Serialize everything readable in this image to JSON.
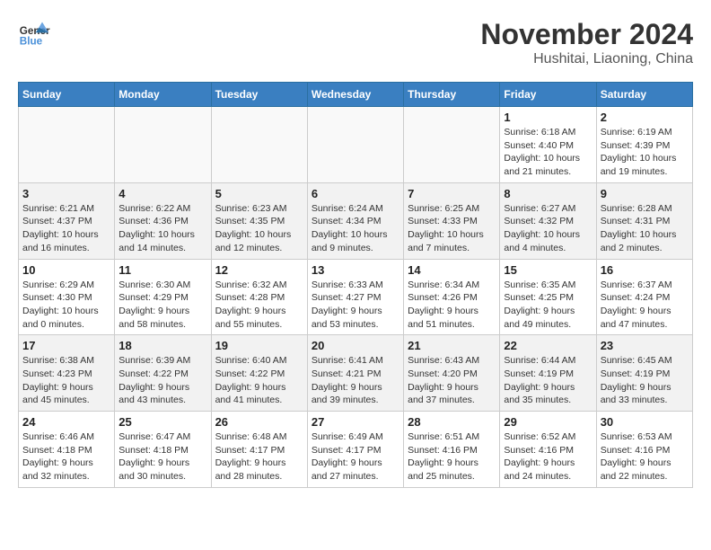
{
  "header": {
    "logo_line1": "General",
    "logo_line2": "Blue",
    "month": "November 2024",
    "location": "Hushitai, Liaoning, China"
  },
  "days_of_week": [
    "Sunday",
    "Monday",
    "Tuesday",
    "Wednesday",
    "Thursday",
    "Friday",
    "Saturday"
  ],
  "weeks": [
    [
      {
        "day": "",
        "info": ""
      },
      {
        "day": "",
        "info": ""
      },
      {
        "day": "",
        "info": ""
      },
      {
        "day": "",
        "info": ""
      },
      {
        "day": "",
        "info": ""
      },
      {
        "day": "1",
        "info": "Sunrise: 6:18 AM\nSunset: 4:40 PM\nDaylight: 10 hours and 21 minutes."
      },
      {
        "day": "2",
        "info": "Sunrise: 6:19 AM\nSunset: 4:39 PM\nDaylight: 10 hours and 19 minutes."
      }
    ],
    [
      {
        "day": "3",
        "info": "Sunrise: 6:21 AM\nSunset: 4:37 PM\nDaylight: 10 hours and 16 minutes."
      },
      {
        "day": "4",
        "info": "Sunrise: 6:22 AM\nSunset: 4:36 PM\nDaylight: 10 hours and 14 minutes."
      },
      {
        "day": "5",
        "info": "Sunrise: 6:23 AM\nSunset: 4:35 PM\nDaylight: 10 hours and 12 minutes."
      },
      {
        "day": "6",
        "info": "Sunrise: 6:24 AM\nSunset: 4:34 PM\nDaylight: 10 hours and 9 minutes."
      },
      {
        "day": "7",
        "info": "Sunrise: 6:25 AM\nSunset: 4:33 PM\nDaylight: 10 hours and 7 minutes."
      },
      {
        "day": "8",
        "info": "Sunrise: 6:27 AM\nSunset: 4:32 PM\nDaylight: 10 hours and 4 minutes."
      },
      {
        "day": "9",
        "info": "Sunrise: 6:28 AM\nSunset: 4:31 PM\nDaylight: 10 hours and 2 minutes."
      }
    ],
    [
      {
        "day": "10",
        "info": "Sunrise: 6:29 AM\nSunset: 4:30 PM\nDaylight: 10 hours and 0 minutes."
      },
      {
        "day": "11",
        "info": "Sunrise: 6:30 AM\nSunset: 4:29 PM\nDaylight: 9 hours and 58 minutes."
      },
      {
        "day": "12",
        "info": "Sunrise: 6:32 AM\nSunset: 4:28 PM\nDaylight: 9 hours and 55 minutes."
      },
      {
        "day": "13",
        "info": "Sunrise: 6:33 AM\nSunset: 4:27 PM\nDaylight: 9 hours and 53 minutes."
      },
      {
        "day": "14",
        "info": "Sunrise: 6:34 AM\nSunset: 4:26 PM\nDaylight: 9 hours and 51 minutes."
      },
      {
        "day": "15",
        "info": "Sunrise: 6:35 AM\nSunset: 4:25 PM\nDaylight: 9 hours and 49 minutes."
      },
      {
        "day": "16",
        "info": "Sunrise: 6:37 AM\nSunset: 4:24 PM\nDaylight: 9 hours and 47 minutes."
      }
    ],
    [
      {
        "day": "17",
        "info": "Sunrise: 6:38 AM\nSunset: 4:23 PM\nDaylight: 9 hours and 45 minutes."
      },
      {
        "day": "18",
        "info": "Sunrise: 6:39 AM\nSunset: 4:22 PM\nDaylight: 9 hours and 43 minutes."
      },
      {
        "day": "19",
        "info": "Sunrise: 6:40 AM\nSunset: 4:22 PM\nDaylight: 9 hours and 41 minutes."
      },
      {
        "day": "20",
        "info": "Sunrise: 6:41 AM\nSunset: 4:21 PM\nDaylight: 9 hours and 39 minutes."
      },
      {
        "day": "21",
        "info": "Sunrise: 6:43 AM\nSunset: 4:20 PM\nDaylight: 9 hours and 37 minutes."
      },
      {
        "day": "22",
        "info": "Sunrise: 6:44 AM\nSunset: 4:19 PM\nDaylight: 9 hours and 35 minutes."
      },
      {
        "day": "23",
        "info": "Sunrise: 6:45 AM\nSunset: 4:19 PM\nDaylight: 9 hours and 33 minutes."
      }
    ],
    [
      {
        "day": "24",
        "info": "Sunrise: 6:46 AM\nSunset: 4:18 PM\nDaylight: 9 hours and 32 minutes."
      },
      {
        "day": "25",
        "info": "Sunrise: 6:47 AM\nSunset: 4:18 PM\nDaylight: 9 hours and 30 minutes."
      },
      {
        "day": "26",
        "info": "Sunrise: 6:48 AM\nSunset: 4:17 PM\nDaylight: 9 hours and 28 minutes."
      },
      {
        "day": "27",
        "info": "Sunrise: 6:49 AM\nSunset: 4:17 PM\nDaylight: 9 hours and 27 minutes."
      },
      {
        "day": "28",
        "info": "Sunrise: 6:51 AM\nSunset: 4:16 PM\nDaylight: 9 hours and 25 minutes."
      },
      {
        "day": "29",
        "info": "Sunrise: 6:52 AM\nSunset: 4:16 PM\nDaylight: 9 hours and 24 minutes."
      },
      {
        "day": "30",
        "info": "Sunrise: 6:53 AM\nSunset: 4:16 PM\nDaylight: 9 hours and 22 minutes."
      }
    ]
  ]
}
